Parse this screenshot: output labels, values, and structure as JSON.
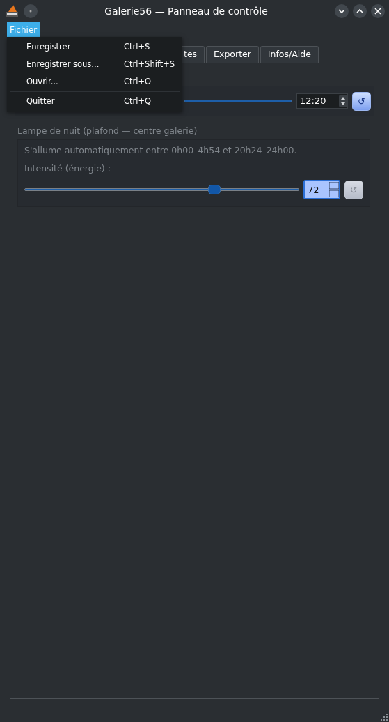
{
  "window": {
    "title": "Galerie56 — Panneau de contrôle"
  },
  "menubar": [
    {
      "label": "Fichier",
      "selected": true
    }
  ],
  "open_menu": {
    "items": [
      {
        "kind": "item",
        "label": "Enregistrer",
        "shortcut": "Ctrl+S"
      },
      {
        "kind": "item",
        "label": "Enregistrer sous...",
        "shortcut": "Ctrl+Shift+S"
      },
      {
        "kind": "item",
        "label": "Ouvrir...",
        "shortcut": "Ctrl+O"
      },
      {
        "kind": "separator"
      },
      {
        "kind": "item",
        "label": "Quitter",
        "shortcut": "Ctrl+Q"
      }
    ]
  },
  "tabs": [
    {
      "label": "tes"
    },
    {
      "label": "Exporter"
    },
    {
      "label": "Infos/Aide"
    }
  ],
  "schedule_group": {
    "time": "12:20",
    "reset_symbol": "↺"
  },
  "night_lamp": {
    "title": "Lampe de nuit (plafond — centre galerie)",
    "disabled": true,
    "description": "S'allume automatiquement entre 0h00–4h54 et 20h24–24h00.",
    "intensity_label": "Intensité (énergie) :",
    "level": 0.69,
    "value": "72",
    "focused": true,
    "reset_symbol": "↺"
  }
}
